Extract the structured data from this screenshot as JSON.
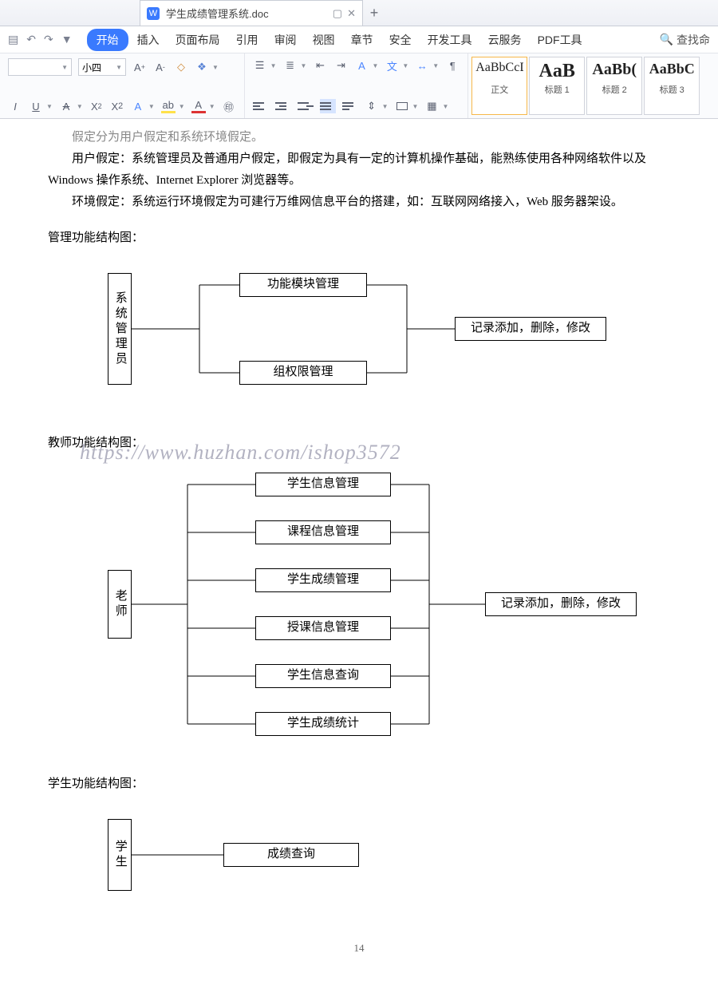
{
  "tab": {
    "title": "学生成绩管理系统.doc",
    "icon": "W"
  },
  "menu": {
    "start": "开始",
    "insert": "插入",
    "layout": "页面布局",
    "ref": "引用",
    "review": "审阅",
    "view": "视图",
    "section": "章节",
    "security": "安全",
    "dev": "开发工具",
    "cloud": "云服务",
    "pdf": "PDF工具",
    "search": "查找命"
  },
  "ribbon": {
    "font_size": "小四",
    "styles": [
      {
        "preview": "AaBbCcDd",
        "name": "正文"
      },
      {
        "preview": "AaB",
        "name": "标题 1"
      },
      {
        "preview": "AaBb(",
        "name": "标题 2"
      },
      {
        "preview": "AaBbC",
        "name": "标题 3"
      }
    ]
  },
  "doc": {
    "line0": "假定分为用户假定和系统环境假定。",
    "p1": "用户假定：系统管理员及普通用户假定，即假定为具有一定的计算机操作基础，能熟练使用各种网络软件以及 Windows 操作系统、Internet Explorer 浏览器等。",
    "p2": "环境假定：系统运行环境假定为可建行万维网信息平台的搭建，如：互联网网络接入，Web 服务器架设。",
    "heading1": "管理功能结构图：",
    "heading2": "教师功能结构图：",
    "heading3": "学生功能结构图：",
    "watermark": "https://www.huzhan.com/ishop3572",
    "page_number": "14",
    "d1": {
      "admin": "系统管理员",
      "b1": "功能模块管理",
      "b2": "组权限管理",
      "out": "记录添加，删除，修改"
    },
    "d2": {
      "teacher": "老师",
      "c1": "学生信息管理",
      "c2": "课程信息管理",
      "c3": "学生成绩管理",
      "c4": "授课信息管理",
      "c5": "学生信息查询",
      "c6": "学生成绩统计",
      "out": "记录添加，删除，修改"
    },
    "d3": {
      "student": "学生",
      "q": "成绩查询"
    }
  }
}
